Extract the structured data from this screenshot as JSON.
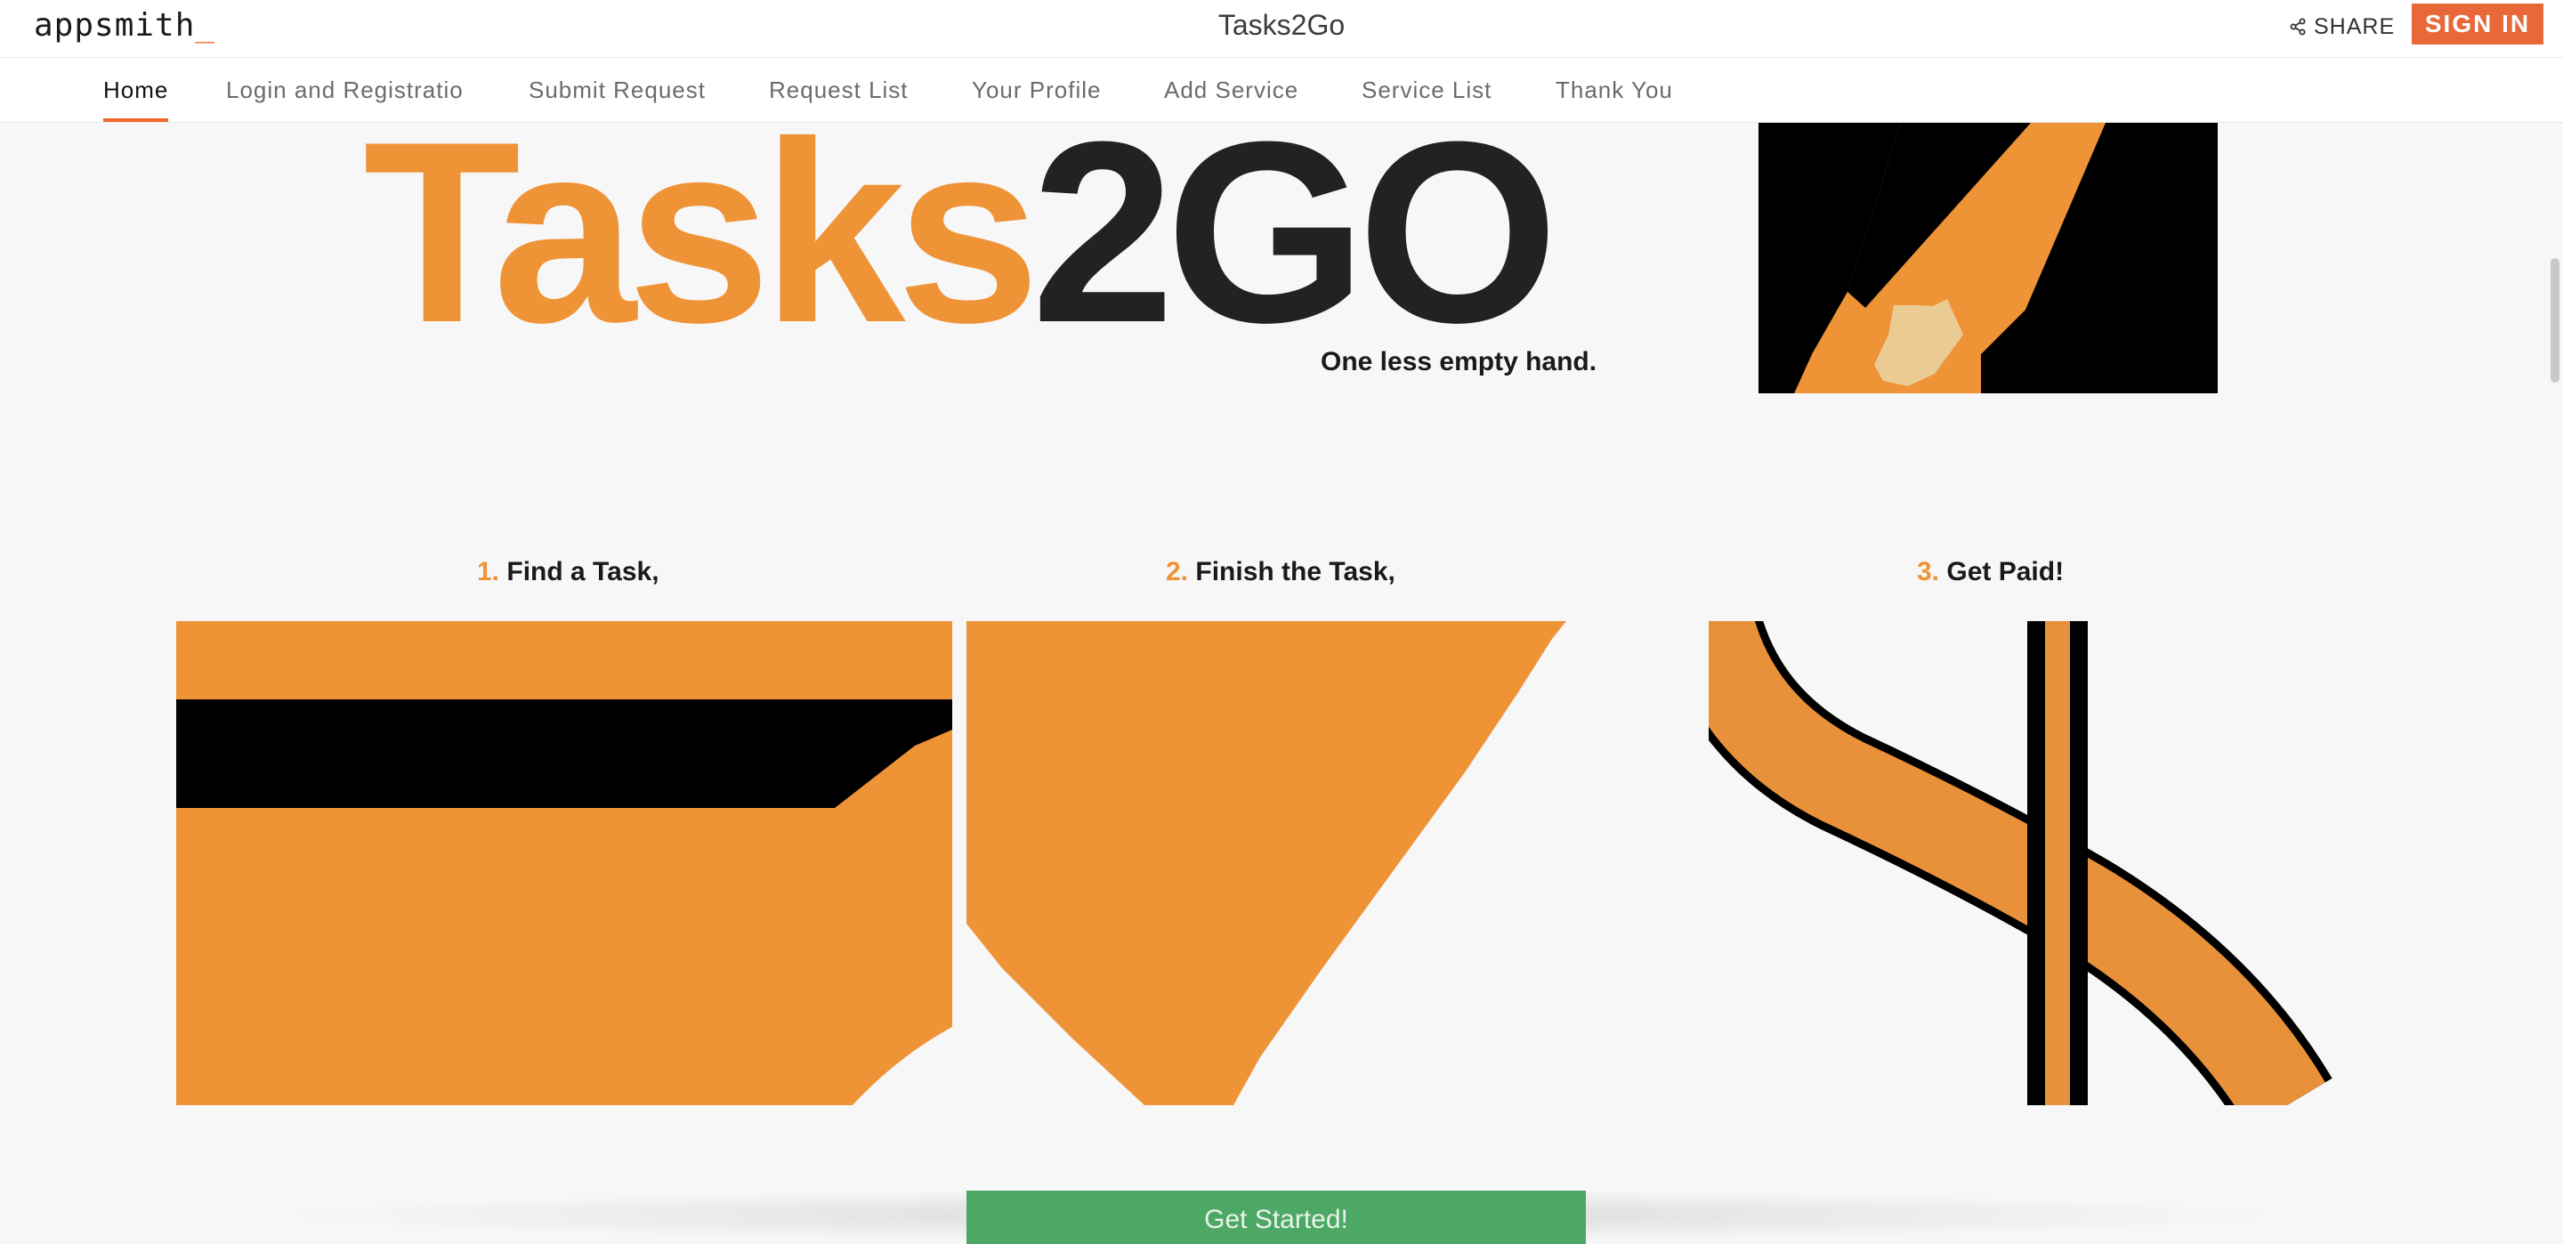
{
  "header": {
    "logo": "appsmith",
    "logo_cursor": "_",
    "title": "Tasks2Go",
    "share_label": "SHARE",
    "share_icon": "share-icon",
    "signin_label": "SIGN IN"
  },
  "tabs": [
    {
      "label": "Home",
      "active": true
    },
    {
      "label": "Login and Registratio"
    },
    {
      "label": "Submit Request"
    },
    {
      "label": "Request List"
    },
    {
      "label": "Your Profile"
    },
    {
      "label": "Add Service"
    },
    {
      "label": "Service List"
    },
    {
      "label": "Thank You"
    }
  ],
  "hero": {
    "brand_orange": "Tasks",
    "brand_dark": "2GO",
    "tagline": "One less empty hand."
  },
  "steps": [
    {
      "num": "1.",
      "text": "Find a Task,"
    },
    {
      "num": "2.",
      "text": "Finish the Task,"
    },
    {
      "num": "3.",
      "text": "Get Paid!"
    }
  ],
  "cta": {
    "label": "Get Started!"
  },
  "colors": {
    "accent": "#f0692b",
    "brand_orange": "#ef9337",
    "cta_green": "#4da865",
    "dark": "#222222"
  }
}
